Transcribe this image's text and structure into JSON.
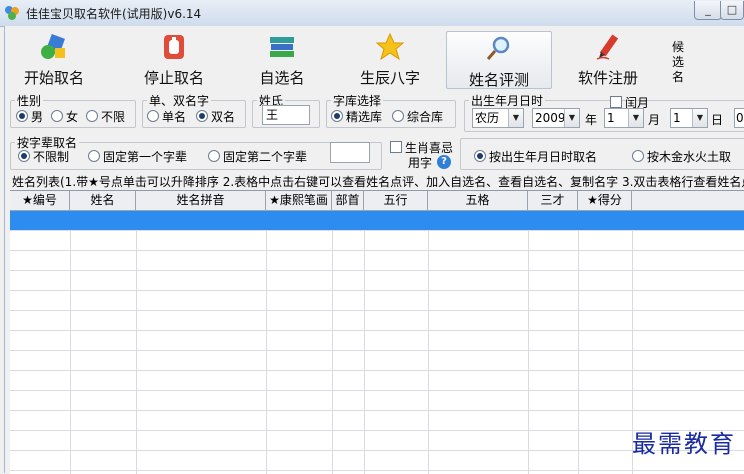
{
  "window": {
    "title": "佳佳宝贝取名软件(试用版)v6.14"
  },
  "toolbar": {
    "buttons": [
      {
        "label": "开始取名",
        "icon": "start-naming-icon"
      },
      {
        "label": "停止取名",
        "icon": "stop-hand-icon"
      },
      {
        "label": "自选名",
        "icon": "books-icon"
      },
      {
        "label": "生辰八字",
        "icon": "star-icon"
      },
      {
        "label": "姓名评测",
        "icon": "magnifier-icon"
      },
      {
        "label": "软件注册",
        "icon": "pencil-icon"
      }
    ],
    "side_label": "候选名"
  },
  "gender": {
    "legend": "性别",
    "options": [
      "男",
      "女",
      "不限"
    ],
    "selected": "男"
  },
  "name_length": {
    "legend": "单、双名字",
    "options": [
      "单名",
      "双名"
    ],
    "selected": "双名"
  },
  "surname": {
    "legend": "姓氏",
    "value": "王"
  },
  "library": {
    "legend": "字库选择",
    "options": [
      "精选库",
      "综合库"
    ],
    "selected": "精选库"
  },
  "birth": {
    "legend": "出生年月日时",
    "leap_label": "闰月",
    "calendar": "农历",
    "year": "2009",
    "year_unit": "年",
    "month": "1",
    "month_unit": "月",
    "day": "1",
    "day_unit": "日",
    "hour_partial": "0"
  },
  "generation": {
    "legend": "按字辈取名",
    "options": [
      "不限制",
      "固定第一个字辈",
      "固定第二个字辈"
    ],
    "selected": "不限制",
    "input_value": ""
  },
  "zodiac": {
    "label_line1": "生肖喜忌",
    "label_line2": "用字"
  },
  "mode": {
    "options": [
      "按出生年月日时取名",
      "按木金水火土取"
    ],
    "selected": "按出生年月日时取名"
  },
  "list": {
    "caption": "姓名列表(1.带★号点单击可以升降排序 2.表格中点击右键可以查看姓名点评、加入自选名、查看自选名、复制名字 3.双击表格行查看姓名点",
    "columns": [
      "★编号",
      "姓名",
      "姓名拼音",
      "★康熙笔画",
      "部首",
      "五行",
      "五格",
      "三才",
      "★得分"
    ]
  },
  "watermark": "最需教育",
  "colors": {
    "selected_row": "#2d8cf0",
    "title_bar": "#cfdcec"
  }
}
